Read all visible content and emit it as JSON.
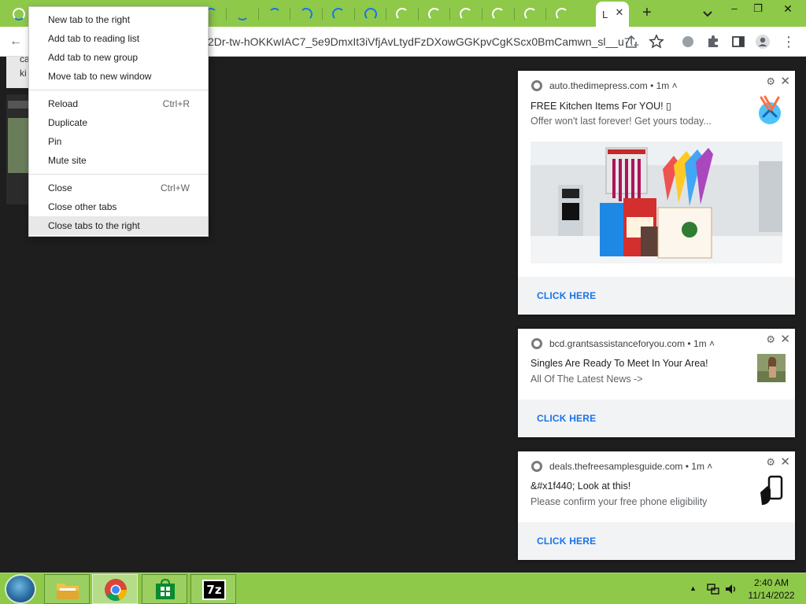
{
  "tabstrip": {
    "active_tab_label": "L",
    "active_tab_close": "✕",
    "new_tab": "+",
    "window_minimize": "–",
    "window_restore": "❐",
    "window_close": "✕"
  },
  "toolbar": {
    "url": "2Dr-tw-hOKKwIAC7_5e9DmxIt3iVfjAvLtydFzDXowGGKpvCgKScx0BmCamwn_sl__u7..."
  },
  "page": {
    "bg_text_line1": "ca",
    "bg_text_line2": "ki"
  },
  "context_menu": {
    "groups": [
      [
        {
          "label": "New tab to the right",
          "shortcut": ""
        },
        {
          "label": "Add tab to reading list",
          "shortcut": ""
        },
        {
          "label": "Add tab to new group",
          "shortcut": ""
        },
        {
          "label": "Move tab to new window",
          "shortcut": ""
        }
      ],
      [
        {
          "label": "Reload",
          "shortcut": "Ctrl+R"
        },
        {
          "label": "Duplicate",
          "shortcut": ""
        },
        {
          "label": "Pin",
          "shortcut": ""
        },
        {
          "label": "Mute site",
          "shortcut": ""
        }
      ],
      [
        {
          "label": "Close",
          "shortcut": "Ctrl+W"
        },
        {
          "label": "Close other tabs",
          "shortcut": ""
        },
        {
          "label": "Close tabs to the right",
          "shortcut": ""
        }
      ]
    ]
  },
  "notifications": [
    {
      "origin": "auto.thedimepress.com  •  1m ˄",
      "title": "FREE Kitchen Items For YOU! ▯",
      "message": "Offer won't last forever! Get yours today...",
      "action": "CLICK HERE",
      "icon": "kitchen-utensils-icon",
      "has_image": true
    },
    {
      "origin": "bcd.grantsassistanceforyou.com  •  1m ˄",
      "title": "Singles Are Ready To Meet In Your Area!",
      "message": "All Of The Latest News ->",
      "action": "CLICK HERE",
      "icon": "person-photo-thumbnail",
      "has_image": false
    },
    {
      "origin": "deals.thefreesamplesguide.com  •  1m ˄",
      "title": "&#x1f440; Look at this!",
      "message": "Please confirm your free phone eligibility",
      "action": "CLICK HERE",
      "icon": "hand-phone-icon",
      "has_image": false
    }
  ],
  "taskbar": {
    "time": "2:40 AM",
    "date": "11/14/2022",
    "apps": [
      "file-explorer-icon",
      "chrome-icon",
      "store-icon",
      "7zip-icon"
    ],
    "seven_zip_label": "7z"
  },
  "colors": {
    "theme_green": "#8ec94a",
    "link_blue": "#1a73e8",
    "spinner_blue": "#1a73e8"
  }
}
